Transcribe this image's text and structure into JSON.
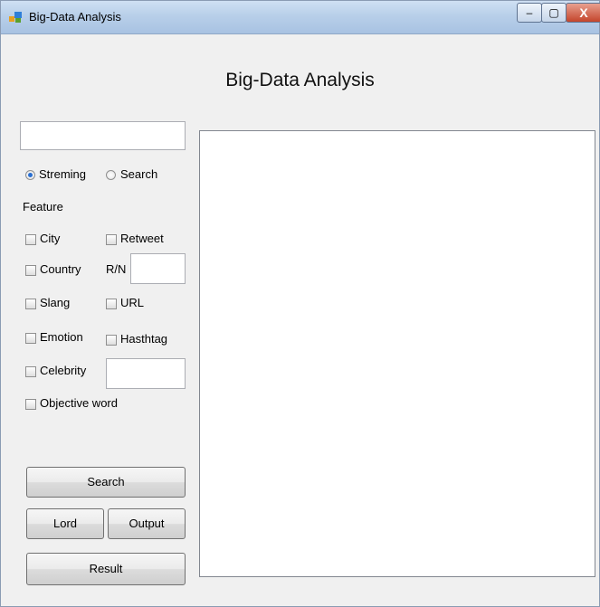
{
  "window": {
    "title": "Big-Data Analysis",
    "controls": {
      "minimize": "–",
      "maximize": "▢",
      "close": "X"
    }
  },
  "heading": "Big-Data Analysis",
  "query_input": {
    "value": ""
  },
  "mode": {
    "options": [
      {
        "label": "Streming",
        "selected": true
      },
      {
        "label": "Search",
        "selected": false
      }
    ]
  },
  "feature": {
    "label": "Feature",
    "checkboxes": {
      "city": "City",
      "retweet": "Retweet",
      "country": "Country",
      "slang": "Slang",
      "url": "URL",
      "emotion": "Emotion",
      "hashtag": "Hasthtag",
      "celebrity": "Celebrity",
      "objective_word": "Objective word"
    },
    "rn_label": "R/N",
    "rn_value": "",
    "celebrity_value": ""
  },
  "buttons": {
    "search": "Search",
    "lord": "Lord",
    "output": "Output",
    "result": "Result"
  },
  "output_area": {
    "value": ""
  },
  "colors": {
    "accent": "#2a6fd1",
    "close_button": "#c4452c",
    "titlebar": "#b8cfe9"
  }
}
